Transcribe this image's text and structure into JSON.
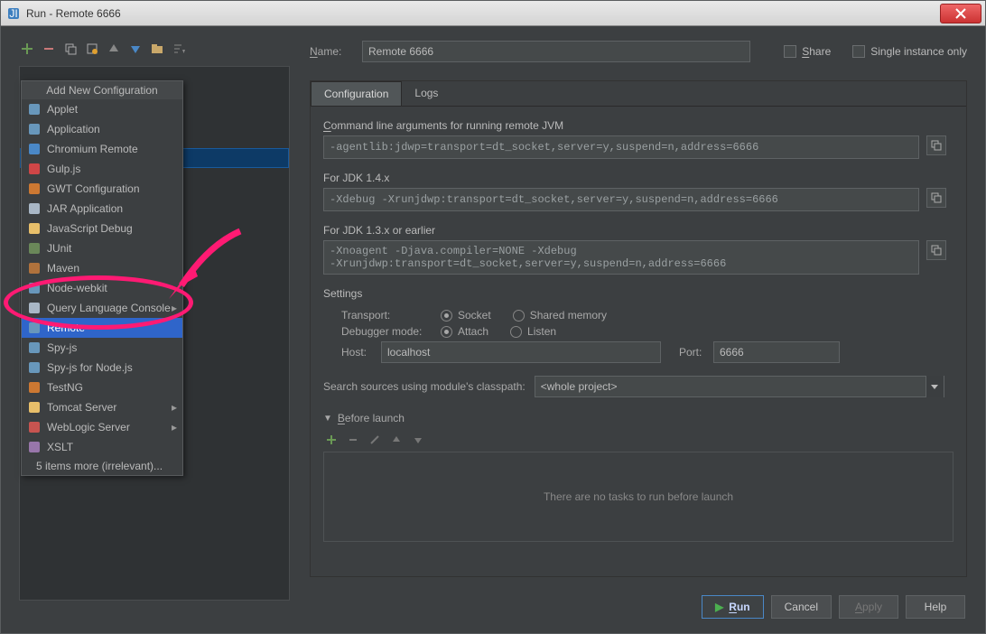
{
  "window": {
    "title": "Run - Remote 6666"
  },
  "toolbar_icons": [
    "add",
    "remove",
    "copy",
    "settings-wrench",
    "up",
    "down",
    "folder",
    "filter"
  ],
  "dropdown": {
    "header": "Add New Configuration",
    "items": [
      {
        "label": "Applet",
        "icon": "applet"
      },
      {
        "label": "Application",
        "icon": "application"
      },
      {
        "label": "Chromium Remote",
        "icon": "chromium"
      },
      {
        "label": "Gulp.js",
        "icon": "gulp"
      },
      {
        "label": "GWT Configuration",
        "icon": "gwt"
      },
      {
        "label": "JAR Application",
        "icon": "jar"
      },
      {
        "label": "JavaScript Debug",
        "icon": "js"
      },
      {
        "label": "JUnit",
        "icon": "junit"
      },
      {
        "label": "Maven",
        "icon": "maven"
      },
      {
        "label": "Node-webkit",
        "icon": "nodewebkit"
      },
      {
        "label": "Query Language Console",
        "icon": "query",
        "submenu": true
      },
      {
        "label": "Remote",
        "icon": "remote",
        "selected": true
      },
      {
        "label": "Spy-js",
        "icon": "spyjs"
      },
      {
        "label": "Spy-js for Node.js",
        "icon": "spyjs-node"
      },
      {
        "label": "TestNG",
        "icon": "testng"
      },
      {
        "label": "Tomcat Server",
        "icon": "tomcat",
        "submenu": true
      },
      {
        "label": "WebLogic Server",
        "icon": "weblogic",
        "submenu": true
      },
      {
        "label": "XSLT",
        "icon": "xslt"
      }
    ],
    "footer": "5 items more (irrelevant)..."
  },
  "form": {
    "name_label": "Name:",
    "name_value": "Remote 6666",
    "share_label": "Share",
    "single_instance_label": "Single instance only",
    "tabs": {
      "configuration": "Configuration",
      "logs": "Logs"
    },
    "cmd_label": "Command line arguments for running remote JVM",
    "cmd_value": "-agentlib:jdwp=transport=dt_socket,server=y,suspend=n,address=6666",
    "jdk14_label": "For JDK 1.4.x",
    "jdk14_value": "-Xdebug -Xrunjdwp:transport=dt_socket,server=y,suspend=n,address=6666",
    "jdk13_label": "For JDK 1.3.x or earlier",
    "jdk13_line1": "-Xnoagent -Djava.compiler=NONE -Xdebug",
    "jdk13_line2": "-Xrunjdwp:transport=dt_socket,server=y,suspend=n,address=6666",
    "settings_label": "Settings",
    "transport_label": "Transport:",
    "transport_options": {
      "socket": "Socket",
      "shared": "Shared memory"
    },
    "debugger_label": "Debugger mode:",
    "debugger_options": {
      "attach": "Attach",
      "listen": "Listen"
    },
    "host_label": "Host:",
    "host_value": "localhost",
    "port_label": "Port:",
    "port_value": "6666",
    "classpath_label": "Search sources using module's classpath:",
    "classpath_value": "<whole project>",
    "before_launch_label": "Before launch",
    "before_launch_empty": "There are no tasks to run before launch"
  },
  "buttons": {
    "run": "Run",
    "cancel": "Cancel",
    "apply": "Apply",
    "help": "Help"
  }
}
